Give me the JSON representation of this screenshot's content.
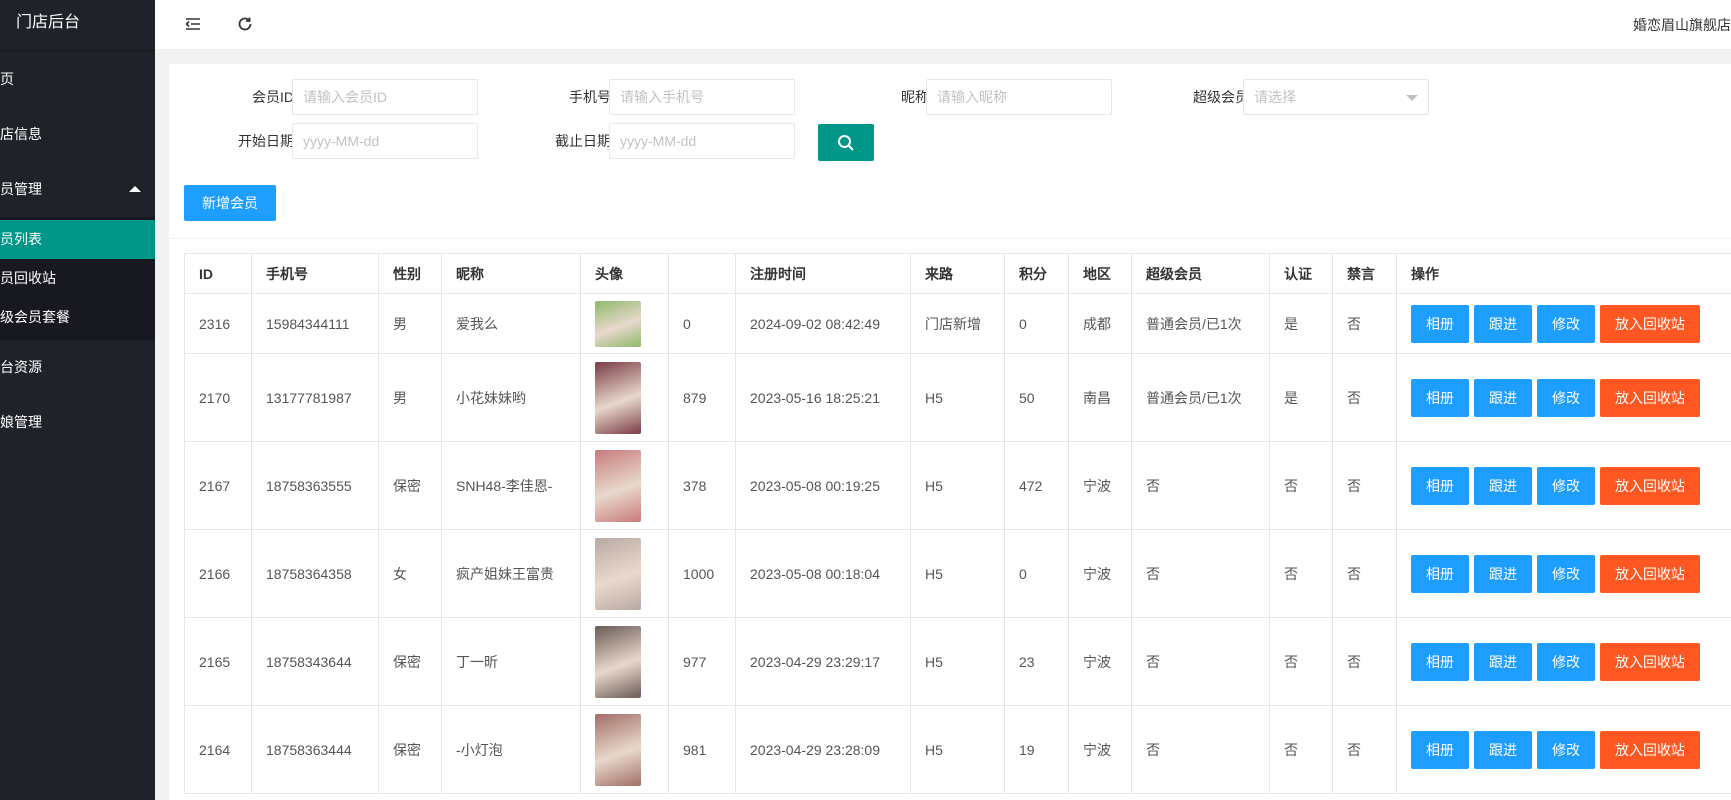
{
  "sidebar": {
    "brand": "门店后台",
    "items": [
      {
        "label": "页"
      },
      {
        "label": "店信息"
      },
      {
        "label": "员管理"
      }
    ],
    "sub_items": [
      {
        "label": "员列表"
      },
      {
        "label": "员回收站"
      },
      {
        "label": "级会员套餐"
      }
    ],
    "items_after": [
      {
        "label": "台资源"
      },
      {
        "label": "娘管理"
      }
    ]
  },
  "header": {
    "shop_name": "婚恋眉山旗舰店"
  },
  "filters": {
    "member_id_label": "会员ID",
    "member_id_placeholder": "请输入会员ID",
    "phone_label": "手机号",
    "phone_placeholder": "请输入手机号",
    "nickname_label": "昵称",
    "nickname_placeholder": "请输入昵称",
    "vip_label": "超级会员",
    "vip_placeholder": "请选择",
    "start_date_label": "开始日期",
    "start_date_placeholder": "yyyy-MM-dd",
    "end_date_label": "截止日期",
    "end_date_placeholder": "yyyy-MM-dd"
  },
  "add_button_label": "新增会员",
  "table": {
    "headers": [
      "ID",
      "手机号",
      "性别",
      "昵称",
      "头像",
      "",
      "注册时间",
      "来路",
      "积分",
      "地区",
      "超级会员",
      "认证",
      "禁言",
      "操作"
    ],
    "actions": [
      "相册",
      "跟进",
      "修改",
      "放入回收站"
    ],
    "rows": [
      {
        "id": "2316",
        "phone": "15984344111",
        "gender": "男",
        "nickname": "爱我么",
        "avatar_color": "#8fb86a",
        "num": "0",
        "reg_time": "2024-09-02 08:42:49",
        "source": "门店新增",
        "points": "0",
        "region": "成都",
        "vip": "普通会员/已1次",
        "verified": "是",
        "muted": "否"
      },
      {
        "id": "2170",
        "phone": "13177781987",
        "gender": "男",
        "nickname": "小花妹妹哟",
        "avatar_color": "#7a3b45",
        "num": "879",
        "reg_time": "2023-05-16 18:25:21",
        "source": "H5",
        "points": "50",
        "region": "南昌",
        "vip": "普通会员/已1次",
        "verified": "是",
        "muted": "否"
      },
      {
        "id": "2167",
        "phone": "18758363555",
        "gender": "保密",
        "nickname": "SNH48-李佳恩-",
        "avatar_color": "#c77b7b",
        "num": "378",
        "reg_time": "2023-05-08 00:19:25",
        "source": "H5",
        "points": "472",
        "region": "宁波",
        "vip": "否",
        "verified": "否",
        "muted": "否"
      },
      {
        "id": "2166",
        "phone": "18758364358",
        "gender": "女",
        "nickname": "疯产姐妹王富贵",
        "avatar_color": "#b9a9a3",
        "num": "1000",
        "reg_time": "2023-05-08 00:18:04",
        "source": "H5",
        "points": "0",
        "region": "宁波",
        "vip": "否",
        "verified": "否",
        "muted": "否"
      },
      {
        "id": "2165",
        "phone": "18758343644",
        "gender": "保密",
        "nickname": "丁一昕",
        "avatar_color": "#6a5a55",
        "num": "977",
        "reg_time": "2023-04-29 23:29:17",
        "source": "H5",
        "points": "23",
        "region": "宁波",
        "vip": "否",
        "verified": "否",
        "muted": "否"
      },
      {
        "id": "2164",
        "phone": "18758363444",
        "gender": "保密",
        "nickname": "-小灯泡",
        "avatar_color": "#a26e66",
        "num": "981",
        "reg_time": "2023-04-29 23:28:09",
        "source": "H5",
        "points": "19",
        "region": "宁波",
        "vip": "否",
        "verified": "否",
        "muted": "否"
      }
    ]
  }
}
